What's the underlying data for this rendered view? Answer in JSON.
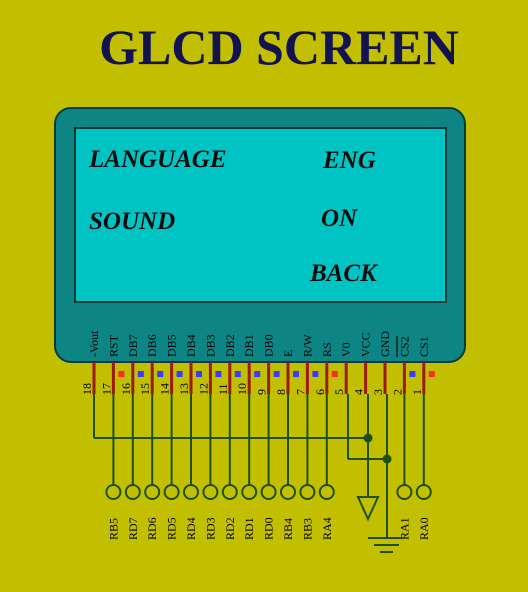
{
  "title": "GLCD SCREEN",
  "screen": {
    "rows": [
      {
        "label": "LANGUAGE",
        "value": "ENG"
      },
      {
        "label": "SOUND",
        "value": "ON"
      },
      {
        "label": "",
        "value": "BACK"
      }
    ]
  },
  "pins": [
    {
      "num": "18",
      "name": "-Vout",
      "port": ""
    },
    {
      "num": "17",
      "name": "RST",
      "port": "RB5"
    },
    {
      "num": "16",
      "name": "DB7",
      "port": "RD7"
    },
    {
      "num": "15",
      "name": "DB6",
      "port": "RD6"
    },
    {
      "num": "14",
      "name": "DB5",
      "port": "RD5"
    },
    {
      "num": "13",
      "name": "DB4",
      "port": "RD4"
    },
    {
      "num": "12",
      "name": "DB3",
      "port": "RD3"
    },
    {
      "num": "11",
      "name": "DB2",
      "port": "RD2"
    },
    {
      "num": "10",
      "name": "DB1",
      "port": "RD1"
    },
    {
      "num": "9",
      "name": "DB0",
      "port": "RD0"
    },
    {
      "num": "8",
      "name": "E",
      "port": "RB4"
    },
    {
      "num": "7",
      "name": "R/W",
      "port": "RB3"
    },
    {
      "num": "6",
      "name": "RS",
      "port": "RA4"
    },
    {
      "num": "5",
      "name": "V0",
      "port": ""
    },
    {
      "num": "4",
      "name": "VCC",
      "port": ""
    },
    {
      "num": "3",
      "name": "GND",
      "port": ""
    },
    {
      "num": "2",
      "name": "CS2",
      "port": "RA1"
    },
    {
      "num": "1",
      "name": "CS1",
      "port": "RA0"
    }
  ],
  "colors": {
    "background": "#c2bf00",
    "title": "#13134f",
    "lcd_body": "#0d8585",
    "lcd_screen": "#00c4c4",
    "wire": "#1f4f14",
    "pin_stub": "#9b1a1a",
    "marker_red": "#ff2a2a",
    "marker_blue": "#3b3bff"
  }
}
